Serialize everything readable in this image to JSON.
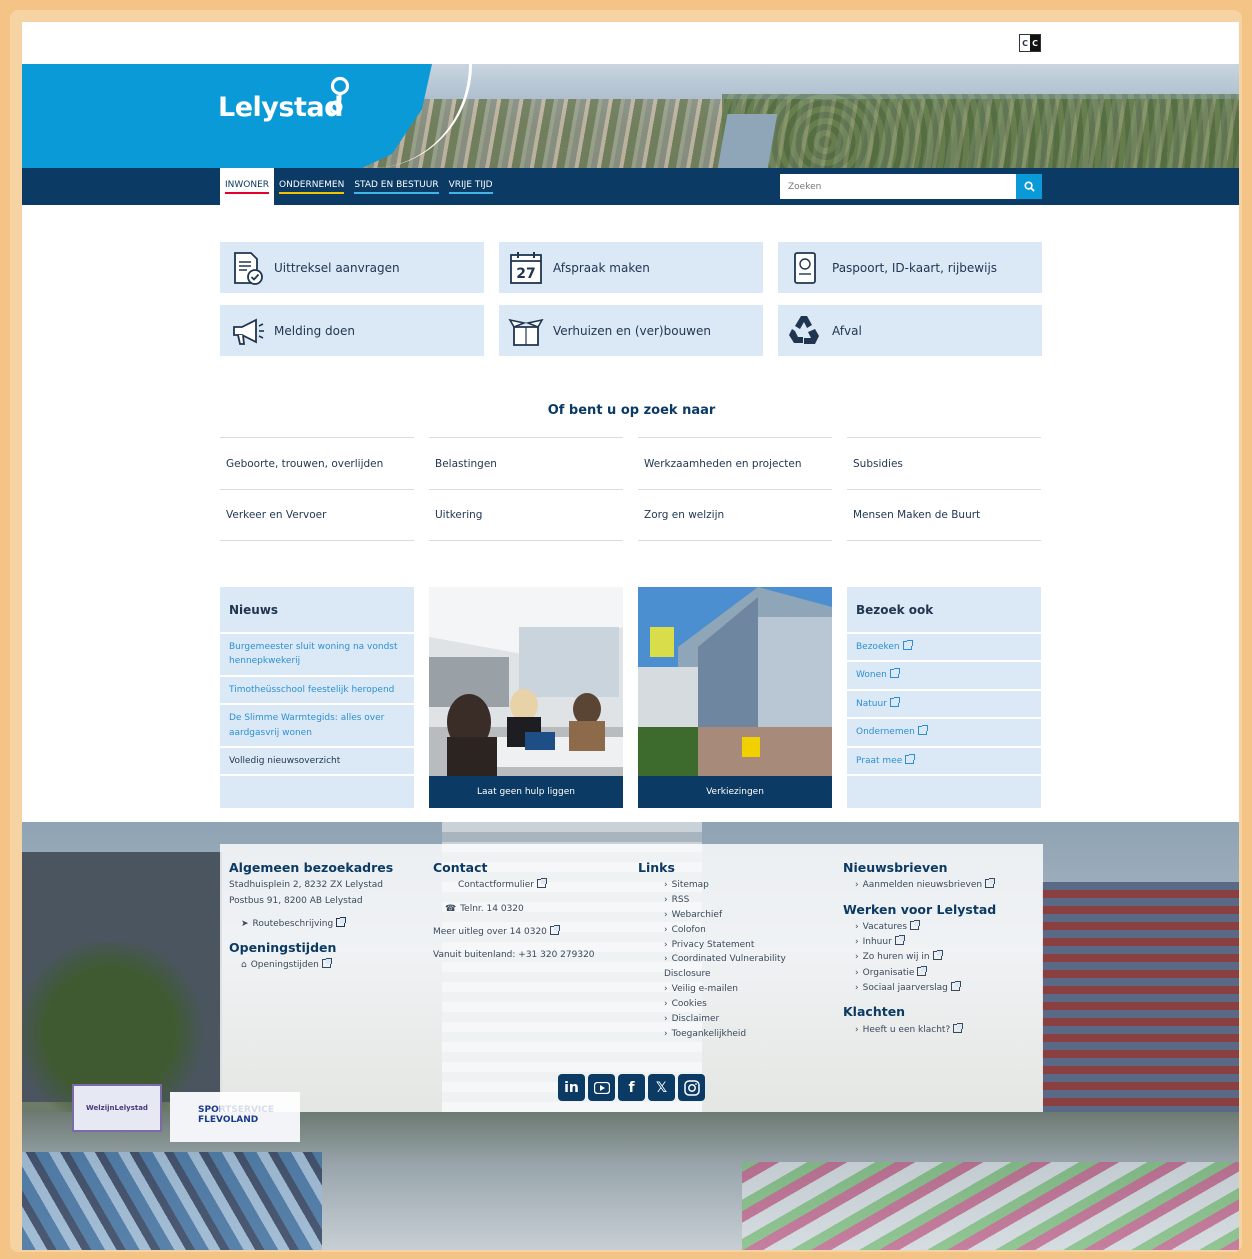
{
  "contrast": {
    "left": "C",
    "right": "C"
  },
  "header": {
    "logo_text": "Lelystad"
  },
  "nav": {
    "items": [
      {
        "label": "INWONER"
      },
      {
        "label": "ONDERNEMEN"
      },
      {
        "label": "STAD EN BESTUUR"
      },
      {
        "label": "VRIJE TIJD"
      }
    ],
    "search_placeholder": "Zoeken"
  },
  "tiles": [
    {
      "label": "Uittreksel aanvragen",
      "icon": "document-check-icon"
    },
    {
      "label": "Afspraak maken",
      "icon": "calendar-27-icon",
      "day": "27"
    },
    {
      "label": "Paspoort, ID-kaart, rijbewijs",
      "icon": "passport-icon"
    },
    {
      "label": "Melding doen",
      "icon": "megaphone-icon"
    },
    {
      "label": "Verhuizen en (ver)bouwen",
      "icon": "moving-box-icon"
    },
    {
      "label": "Afval",
      "icon": "recycle-icon"
    }
  ],
  "zoek": {
    "title": "Of bent u op zoek naar",
    "items": [
      "Geboorte, trouwen, overlijden",
      "Belastingen",
      "Werkzaamheden en projecten",
      "Subsidies",
      "Verkeer en Vervoer",
      "Uitkering",
      "Zorg en welzijn",
      "Mensen Maken de Buurt"
    ]
  },
  "news": {
    "title": "Nieuws",
    "items": [
      "Burgemeester sluit woning na vondst hennepkwekerij",
      "Timotheüsschool feestelijk heropend",
      "De Slimme Warmtegids: alles over aardgasvrij wonen"
    ],
    "overview": "Volledig nieuwsoverzicht"
  },
  "photos": [
    {
      "caption": "Laat geen hulp liggen"
    },
    {
      "caption": "Verkiezingen"
    }
  ],
  "bezoek": {
    "title": "Bezoek ook",
    "items": [
      "Bezoeken",
      "Wonen",
      "Natuur",
      "Ondernemen",
      "Praat mee"
    ]
  },
  "footer": {
    "adres": {
      "title": "Algemeen bezoekadres",
      "line1": "Stadhuisplein 2, 8232 ZX Lelystad",
      "line2": "Postbus 91, 8200 AB Lelystad",
      "route": "Routebeschrijving"
    },
    "openingstijden": {
      "title": "Openingstijden",
      "link": "Openingstijden"
    },
    "contact": {
      "title": "Contact",
      "form": "Contactformulier",
      "phone": "Telnr. 14 0320",
      "uitleg": "Meer uitleg over 14 0320",
      "buitenland": "Vanuit buitenland: +31 320 279320"
    },
    "links": {
      "title": "Links",
      "items": [
        "Sitemap",
        "RSS",
        "Webarchief",
        "Colofon",
        "Privacy Statement",
        "Coordinated Vulnerability",
        "Veilig e-mailen",
        "Cookies",
        "Disclaimer",
        "Toegankelijkheid"
      ],
      "cvd_cont": "Disclosure"
    },
    "nieuwsbrieven": {
      "title": "Nieuwsbrieven",
      "item": "Aanmelden nieuwsbrieven"
    },
    "werken": {
      "title": "Werken voor Lelystad",
      "items": [
        "Vacatures",
        "Inhuur",
        "Zo huren wij in",
        "Organisatie",
        "Sociaal jaarverslag"
      ]
    },
    "klachten": {
      "title": "Klachten",
      "item": "Heeft u een klacht?"
    },
    "socials": [
      "linkedin-icon",
      "youtube-icon",
      "facebook-icon",
      "x-icon",
      "instagram-icon"
    ],
    "social_letters": {
      "linkedin": "in",
      "facebook": "f",
      "x": "𝕏"
    },
    "banners": {
      "welzijn": "WelzijnLelystad",
      "sport": "SPORTSERVICE FLEVOLAND"
    }
  }
}
